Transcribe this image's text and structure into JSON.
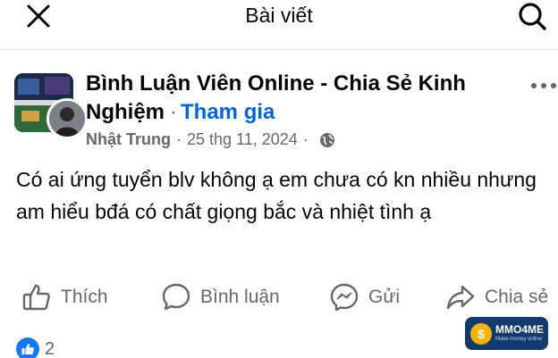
{
  "header": {
    "title": "Bài viết",
    "close_icon": "close-icon",
    "search_icon": "search-icon"
  },
  "post": {
    "group_name": "Bình Luận Viên Online - Chia Sẻ Kinh Nghiệm",
    "join_label": "Tham gia",
    "author": "Nhật Trung",
    "date": "25 thg 11, 2024",
    "privacy_icon": "globe-icon",
    "more_icon": "more-options-icon",
    "text": "Có ai ứng tuyển blv không ạ em chưa có kn nhiều nhưng am hiểu bđá có chất giọng bắc và nhiệt tình ạ"
  },
  "actions": {
    "like": "Thích",
    "comment": "Bình luận",
    "send": "Gửi",
    "share": "Chia sẻ"
  },
  "reactions": {
    "count": "2",
    "icon": "like-reaction-icon"
  },
  "watermark": {
    "brand": "MMO4ME",
    "tagline": "Make money online"
  },
  "colors": {
    "link_blue": "#0064d1",
    "reaction_blue": "#1877f2",
    "secondary_text": "#65676b",
    "primary_text": "#050505"
  }
}
